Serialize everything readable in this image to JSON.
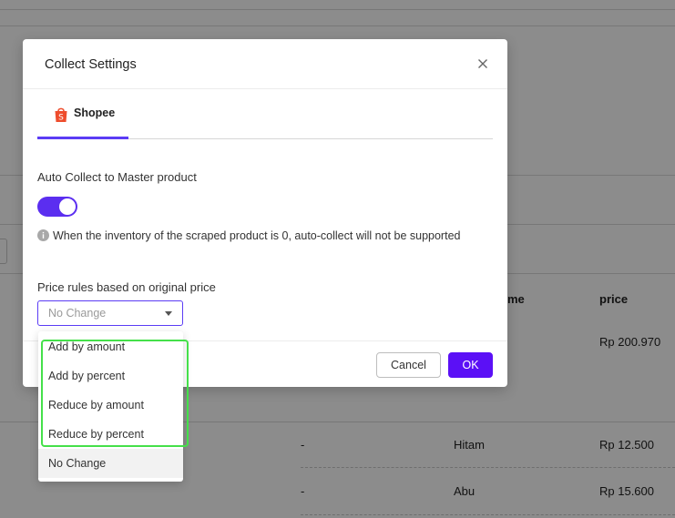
{
  "background": {
    "table": {
      "headers": {
        "name_partial": "me",
        "price": "price"
      },
      "rows": [
        {
          "col1": "",
          "name": "",
          "price": "Rp 200.970"
        },
        {
          "col1": "-",
          "name": "Hitam",
          "price": "Rp 12.500"
        },
        {
          "col1": "-",
          "name": "Abu",
          "price": "Rp 15.600"
        }
      ]
    }
  },
  "modal": {
    "title": "Collect Settings",
    "close_icon": "close-icon",
    "tabs": [
      {
        "label": "Shopee",
        "icon": "shopee-bag-icon",
        "active": true
      }
    ],
    "auto_collect": {
      "label": "Auto Collect to Master product",
      "enabled": true,
      "note": "When the inventory of the scraped product is 0, auto-collect will not be supported",
      "note_icon": "info-icon"
    },
    "price_rules": {
      "label": "Price rules based on original price",
      "selected": "No Change",
      "options": [
        "Add by amount",
        "Add by percent",
        "Reduce by amount",
        "Reduce by percent",
        "No Change"
      ]
    },
    "buttons": {
      "cancel": "Cancel",
      "ok": "OK"
    }
  },
  "colors": {
    "accent": "#5b3cf5",
    "ok_button": "#5b10f6",
    "highlight": "#45e04a",
    "shopee": "#ee4d2d"
  }
}
